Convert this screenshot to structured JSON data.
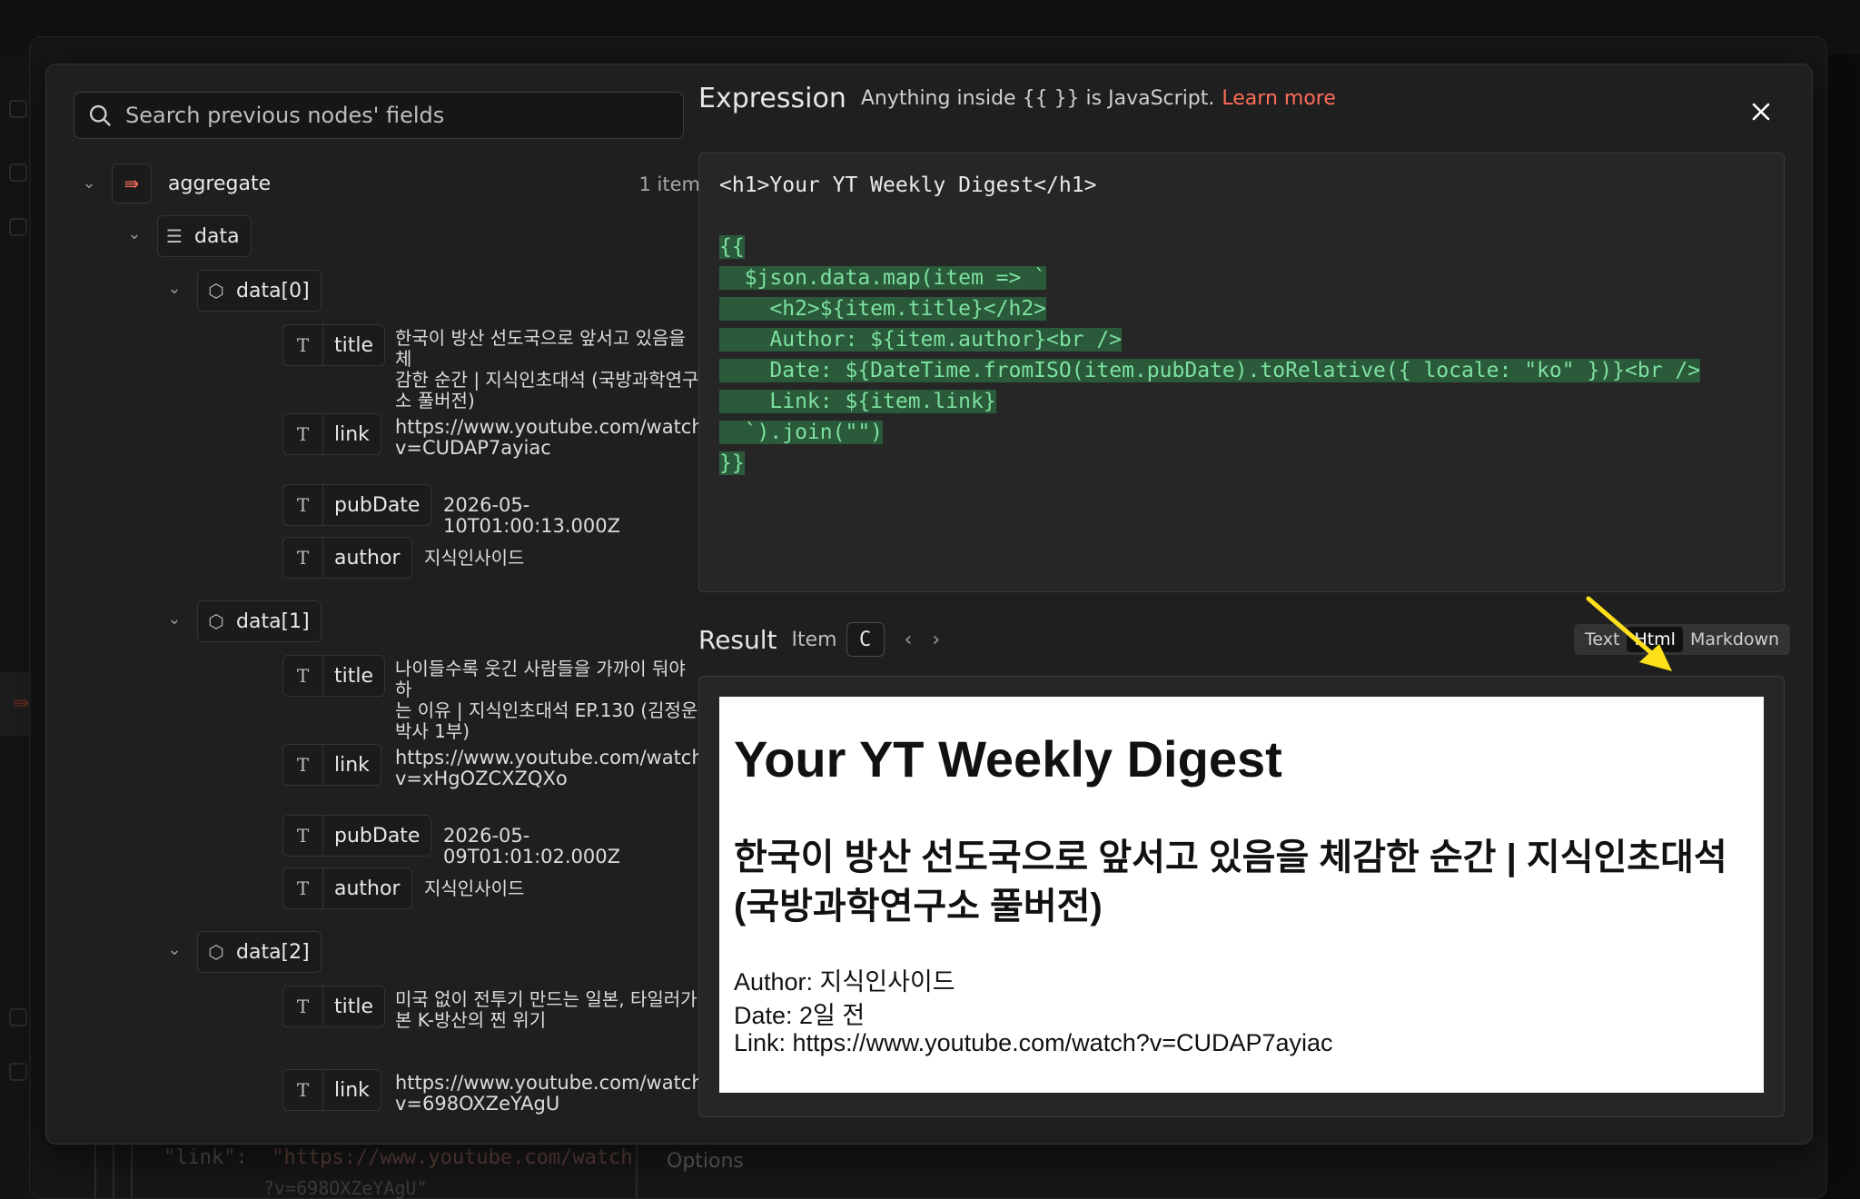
{
  "search": {
    "placeholder": "Search previous nodes' fields"
  },
  "tree": {
    "root": {
      "label": "aggregate",
      "count": "1 item"
    },
    "data_label": "data",
    "items": [
      {
        "label": "data[0]",
        "fields": [
          {
            "name": "title",
            "value": [
              "한국이 방산 선도국으로 앞서고 있음을 체",
              "감한 순간 | 지식인초대석 (국방과학연구",
              "소 풀버전)"
            ]
          },
          {
            "name": "link",
            "value": [
              "https://www.youtube.com/watch?",
              "v=CUDAP7ayiac"
            ]
          },
          {
            "name": "pubDate",
            "value": [
              "2026-05-10T01:00:13.000Z"
            ]
          },
          {
            "name": "author",
            "value": [
              "지식인사이드"
            ]
          }
        ]
      },
      {
        "label": "data[1]",
        "fields": [
          {
            "name": "title",
            "value": [
              "나이들수록 웃긴 사람들을 가까이 둬야 하",
              "는 이유 | 지식인초대석 EP.130 (김정운",
              "박사 1부)"
            ]
          },
          {
            "name": "link",
            "value": [
              "https://www.youtube.com/watch?",
              "v=xHgOZCXZQXo"
            ]
          },
          {
            "name": "pubDate",
            "value": [
              "2026-05-09T01:01:02.000Z"
            ]
          },
          {
            "name": "author",
            "value": [
              "지식인사이드"
            ]
          }
        ]
      },
      {
        "label": "data[2]",
        "fields": [
          {
            "name": "title",
            "value": [
              "미국 없이 전투기 만드는 일본, 타일러가",
              "본 K-방산의 찐 위기"
            ]
          },
          {
            "name": "link",
            "value": [
              "https://www.youtube.com/watch?",
              "v=698OXZeYAgU"
            ]
          }
        ]
      }
    ]
  },
  "expression": {
    "title": "Expression",
    "subtitle": "Anything inside {{ }} is JavaScript.",
    "learn_more": "Learn more",
    "code": [
      "<h1>Your YT Weekly Digest</h1>",
      "",
      "{{",
      "  $json.data.map(item => `",
      "    <h2>${item.title}</h2>",
      "    Author: ${item.author}<br />",
      "    Date: ${DateTime.fromISO(item.pubDate).toRelative({ locale: \"ko\" })}<br />",
      "    Link: ${item.link}",
      "  `).join(\"\")",
      "}}"
    ]
  },
  "result": {
    "title": "Result",
    "item_label": "Item",
    "item_value": "C",
    "prev": "‹",
    "next": "›",
    "tabs": [
      "Text",
      "Html",
      "Markdown"
    ],
    "selected_tab": "Html",
    "preview": {
      "h1": "Your YT Weekly Digest",
      "h2": "한국이 방산 선도국으로 앞서고 있음을 체감한 순간 | 지식인초대석 (국방과학연구소 풀버전)",
      "author": "Author: 지식인사이드",
      "date": "Date: 2일 전",
      "link": "Link: https://www.youtube.com/watch?v=CUDAP7ayiac"
    }
  },
  "background": {
    "json_key": "\"link\":",
    "json_value": "\"https://www.youtube.com/watch",
    "json_value2": "?v=698OXZeYAgU\"",
    "options": "Options"
  },
  "colors": {
    "accent": "#ff6d5a",
    "highlight_bg": "#2a5a3a",
    "highlight_text": "#7ee0a0",
    "arrow": "#ffe01a"
  }
}
